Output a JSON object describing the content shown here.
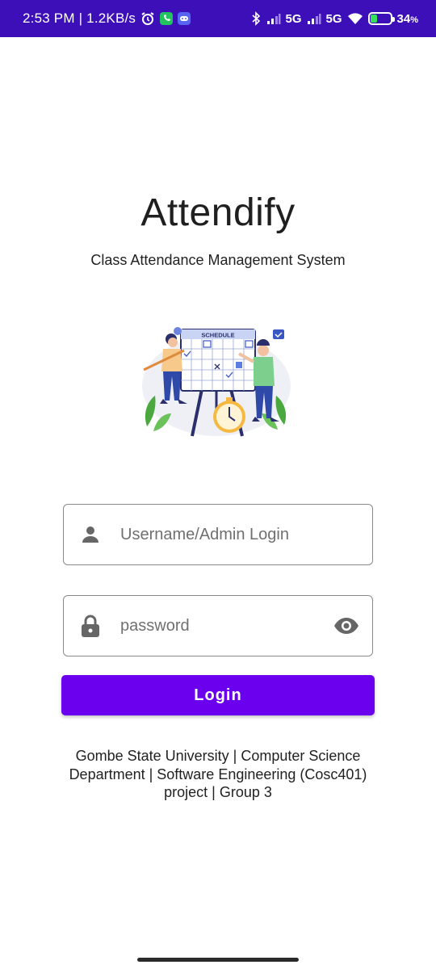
{
  "status_bar": {
    "time_speed": "2:53 PM | 1.2KB/s",
    "network1": "5G",
    "network2": "5G",
    "battery_percent": "34",
    "battery_unit": "%",
    "battery_level": 0.34,
    "icons": [
      "alarm-icon",
      "phone-app-icon",
      "discord-app-icon",
      "bluetooth-icon",
      "signal-icon",
      "wifi-icon",
      "battery-icon"
    ]
  },
  "header": {
    "title": "Attendify",
    "subtitle": "Class Attendance Management System"
  },
  "illustration": {
    "board_label": "SCHEDULE"
  },
  "form": {
    "username_placeholder": "Username/Admin Login",
    "password_placeholder": "password",
    "login_label": "Login"
  },
  "footer": {
    "text": "Gombe State University | Computer Science Department | Software Engineering (Cosc401) project | Group 3"
  },
  "colors": {
    "status_bar": "#3d0fb8",
    "primary": "#6a00ee",
    "field_border": "#8a8a8a",
    "icon_grey": "#666666"
  }
}
